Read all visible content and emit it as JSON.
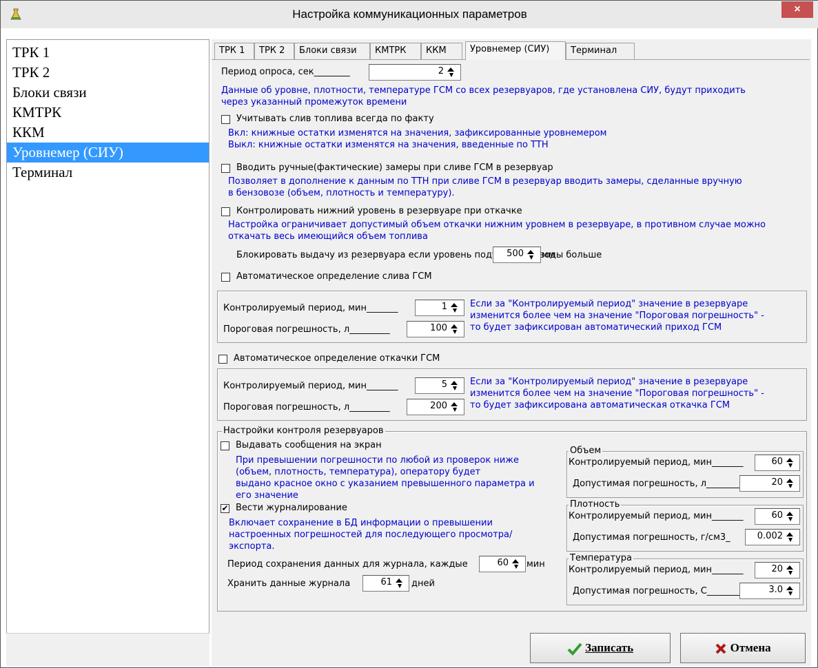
{
  "window": {
    "title": "Настройка коммуникационных параметров",
    "close_glyph": "×"
  },
  "sidebar": {
    "items": [
      "ТРК 1",
      "ТРК 2",
      "Блоки связи",
      "КМТРК",
      "ККМ",
      "Уровнемер (СИУ)",
      "Терминал"
    ],
    "selected": "Уровнемер (СИУ)"
  },
  "tabs": [
    {
      "label": "ТРК 1"
    },
    {
      "label": "ТРК 2"
    },
    {
      "label": "Блоки связи"
    },
    {
      "label": "КМТРК"
    },
    {
      "label": "ККМ"
    },
    {
      "label": "Уровнемер (СИУ)"
    },
    {
      "label": "Терминал"
    }
  ],
  "poll": {
    "label": "Период опроса, сек",
    "value": "2",
    "info": [
      "Данные об уровне, плотности, температуре ГСМ со всех резервуаров, где установлена СИУ, будут приходить",
      "через указанный промежуток времени"
    ]
  },
  "fact_drain": {
    "label": "Учитывать слив топлива всегда по факту",
    "checked": false,
    "info": [
      "Вкл: книжные остатки изменятся на значения, зафиксированные уровнемером",
      "Выкл: книжные остатки изменятся на значения, введенные по ТТН"
    ]
  },
  "manual": {
    "label": "Вводить ручные(фактические) замеры при сливе ГСМ в резервуар",
    "checked": false,
    "info": [
      "Позволяет в дополнение к данным по ТТН при сливе ГСМ в резервуар вводить замеры, сделанные вручную",
      "в бензовозе (объем, плотность и температуру)."
    ]
  },
  "low_level": {
    "label": "Контролировать нижний уровень в резервуаре при откачке",
    "checked": false,
    "info": [
      "Настройка ограничивает допустимый объем откачки нижним уровнем в резервуаре, в противном случае можно",
      "откачать весь имеющийся объем топлива"
    ]
  },
  "water": {
    "label": "Блокировать выдачу из резервуара если уровень подтоварной воды больше",
    "value": "500",
    "unit": "мм"
  },
  "auto_drain": {
    "label": "Автоматическое определение слива ГСМ",
    "checked": false,
    "period_label": "Контролируемый период, мин",
    "period_value": "1",
    "err_label": "Пороговая погрешность, л",
    "err_value": "100",
    "info": [
      "Если за \"Контролируемый период\" значение в резервуаре",
      "изменится более чем на значение \"Пороговая погрешность\" -",
      "то будет зафиксирован автоматический приход ГСМ"
    ]
  },
  "auto_pump": {
    "label": "Автоматическое определение откачки ГСМ",
    "checked": false,
    "period_label": "Контролируемый период, мин",
    "period_value": "5",
    "err_label": "Пороговая погрешность, л",
    "err_value": "200",
    "info": [
      "Если за \"Контролируемый период\" значение в резервуаре",
      "изменится более чем на значение \"Пороговая погрешность\" -",
      "то будет зафиксирована автоматическая откачка ГСМ"
    ]
  },
  "tank_control": {
    "legend": "Настройки контроля резервуаров",
    "messages": {
      "label": "Выдавать сообщения на экран",
      "checked": false,
      "info": [
        "При превышении погрешности по любой из проверок ниже",
        "(объем, плотность, температура), оператору будет",
        "выдано красное окно с указанием превышенного параметра и",
        "его значение"
      ]
    },
    "logging": {
      "label": "Вести журналирование",
      "checked": true,
      "check_glyph": "✔",
      "info": [
        "Включает сохранение в БД информации о превышении",
        "настроенных погрешностей для последующего просмотра/",
        "экспорта."
      ]
    },
    "save_period": {
      "label": "Период сохранения данных для журнала, каждые",
      "value": "60",
      "unit": "мин"
    },
    "keep": {
      "label": "Хранить данные журнала",
      "value": "61",
      "unit": "дней"
    },
    "volume": {
      "legend": "Объем",
      "period_label": "Контролируемый период, мин",
      "period_value": "60",
      "err_label": "Допустимая погрешность, л",
      "err_value": "20"
    },
    "density": {
      "legend": "Плотность",
      "period_label": "Контролируемый период, мин",
      "period_value": "60",
      "err_label": "Допустимая погрешность, г/см3",
      "err_value": "0.002"
    },
    "temperature": {
      "legend": "Температура",
      "period_label": "Контролируемый период, мин",
      "period_value": "20",
      "err_label": "Допустимая погрешность, С",
      "err_value": "3.0"
    }
  },
  "buttons": {
    "save": {
      "label": "Записать",
      "icon": "check-icon",
      "color": "#2e9e2e"
    },
    "cancel": {
      "label": "Отмена",
      "icon": "cross-icon",
      "color": "#b01818"
    }
  },
  "colors": {
    "selection": "#3399ff",
    "info_text": "#0000cc",
    "close_button": "#c75050"
  }
}
